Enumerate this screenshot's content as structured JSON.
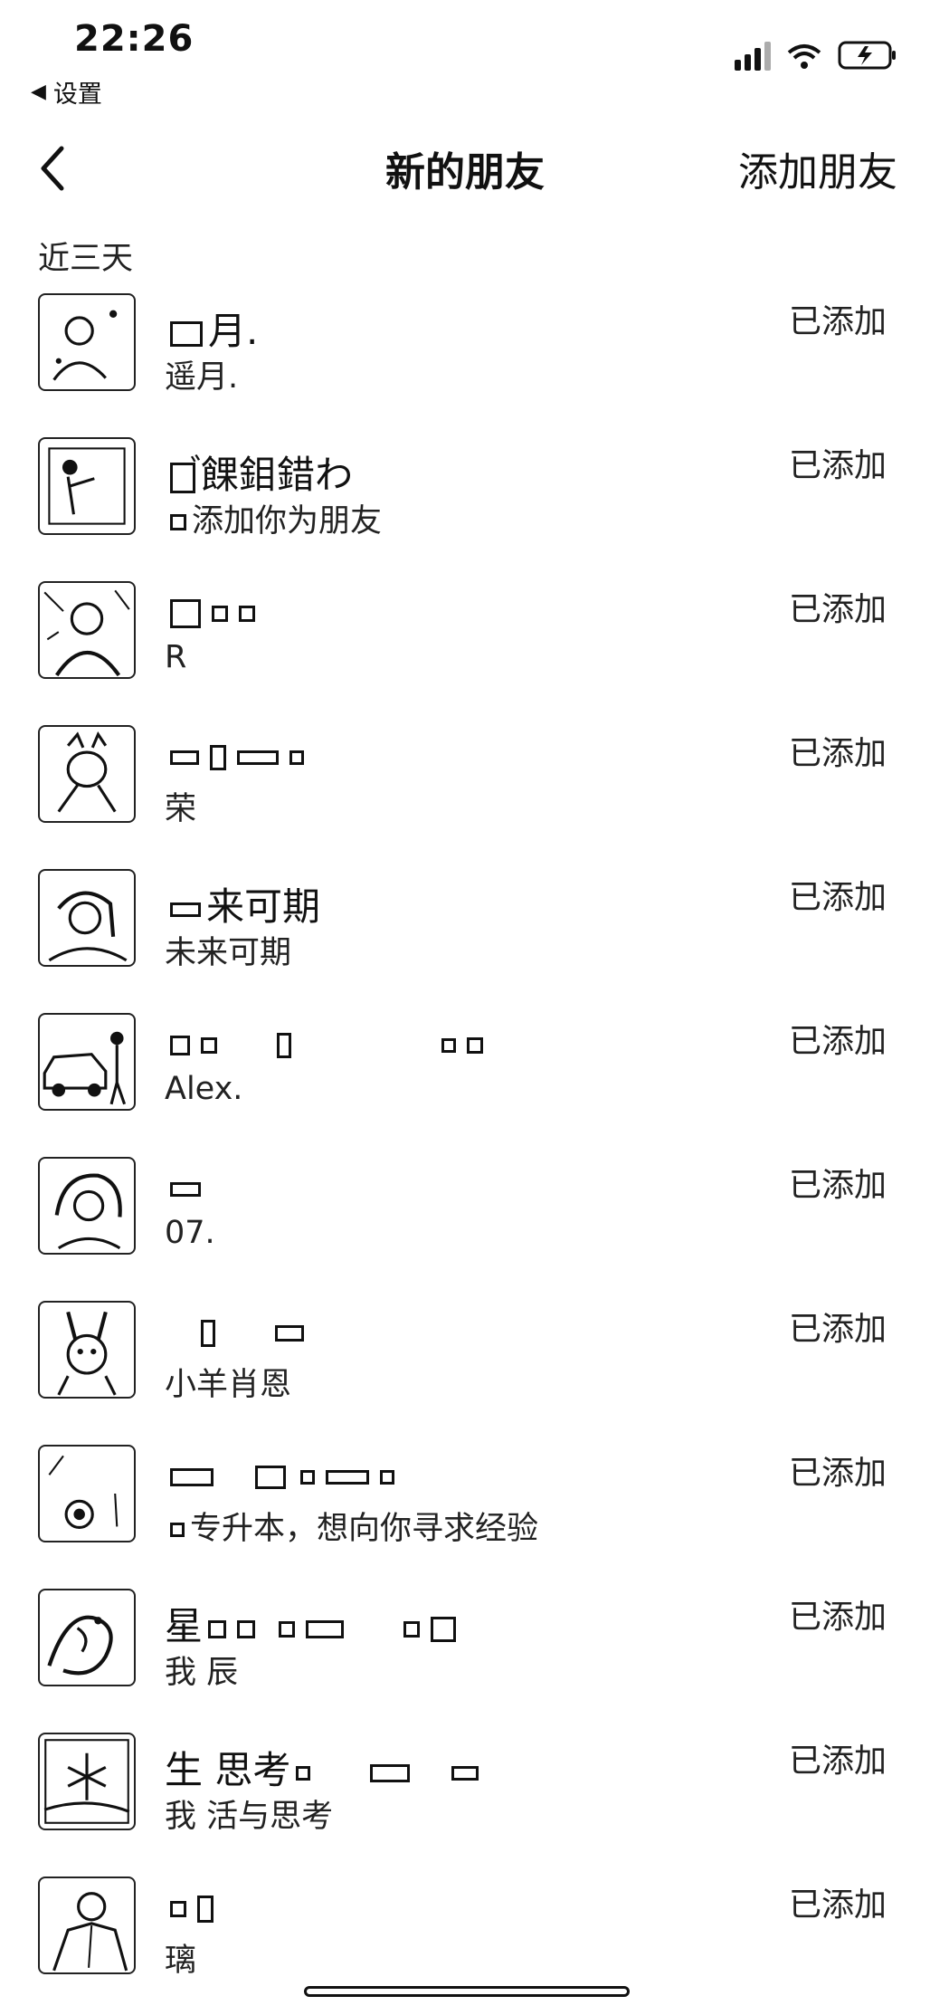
{
  "status_bar": {
    "time": "22:26",
    "back_app": "设置"
  },
  "nav": {
    "title": "新的朋友",
    "add_friend": "添加朋友"
  },
  "section": {
    "header": "近三天"
  },
  "contacts": [
    {
      "name": "月.",
      "note": "遥月.",
      "status": "已添加"
    },
    {
      "name": "゙餜鉬錯わ",
      "note": "添加你为朋友",
      "status": "已添加"
    },
    {
      "name": "",
      "note": "R",
      "status": "已添加"
    },
    {
      "name": "",
      "note": "荣",
      "status": "已添加"
    },
    {
      "name": "来可期",
      "note": "未来可期",
      "status": "已添加"
    },
    {
      "name": "",
      "note": "Alex.",
      "status": "已添加"
    },
    {
      "name": "",
      "note": "07.",
      "status": "已添加"
    },
    {
      "name": "",
      "note": "小羊肖恩",
      "status": "已添加"
    },
    {
      "name": "",
      "note": "专升本，想向你寻求经验",
      "status": "已添加"
    },
    {
      "name": "星",
      "note": "我 辰",
      "status": "已添加"
    },
    {
      "name": "生 思考",
      "note": "我 活与思考",
      "status": "已添加"
    },
    {
      "name": "",
      "note": "璃",
      "status": "已添加"
    }
  ]
}
